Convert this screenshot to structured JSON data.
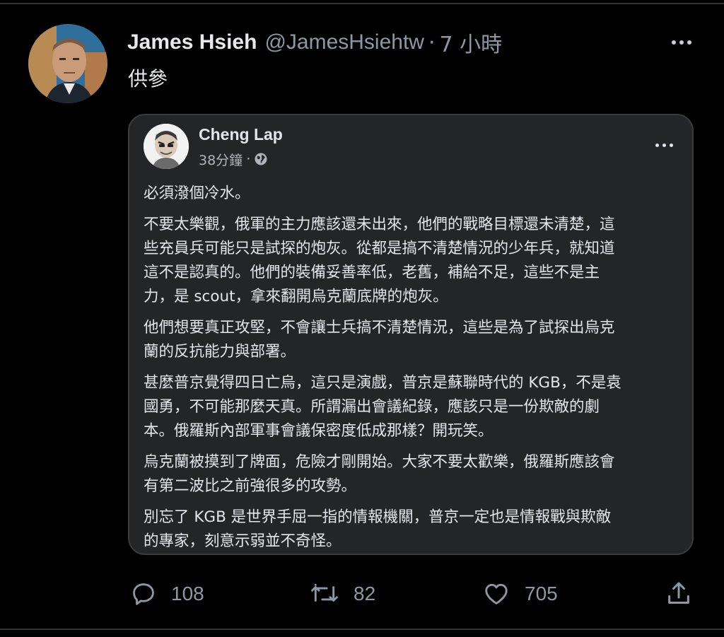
{
  "tweet": {
    "author_name": "James Hsieh",
    "author_handle": "@JamesHsiehtw",
    "separator": "·",
    "time_ago": "7 小時",
    "text": "供參",
    "icons": {
      "avatar": "profile-photo",
      "more": "more-horizontal-icon"
    }
  },
  "quoted_post": {
    "author_name": "Cheng Lap",
    "time_ago": "38分鐘",
    "separator": "·",
    "audience_icon": "globe-icon",
    "paragraphs": [
      "必須潑個冷水。",
      "不要太樂觀，俄軍的主力應該還未出來，他們的戰略目標還未清楚，這\n些充員兵可能只是試探的炮灰。從都是搞不清楚情況的少年兵，就知道\n這不是認真的。他們的裝備妥善率低，老舊，補給不足，這些不是主\n力，是 scout，拿來翻開烏克蘭底牌的炮灰。",
      "他們想要真正攻堅，不會讓士兵搞不清楚情況，這些是為了試探出烏克\n蘭的反抗能力與部署。",
      "甚麼普京覺得四日亡烏，這只是演戲，普京是蘇聯時代的 KGB，不是袁\n國勇，不可能那麼天真。所謂漏出會議紀錄，應該只是一份欺敵的劇\n本。俄羅斯內部軍事會議保密度低成那樣？開玩笑。",
      "烏克蘭被摸到了牌面，危險才剛開始。大家不要太歡樂，俄羅斯應該會\n有第二波比之前強很多的攻勢。",
      "別忘了 KGB 是世界手屈一指的情報機關，普京一定也是情報戰與欺敵\n的專家，刻意示弱並不奇怪。"
    ]
  },
  "actions": {
    "reply_count": "108",
    "retweet_count": "82",
    "like_count": "705",
    "icons": [
      "reply-icon",
      "retweet-icon",
      "like-icon",
      "share-icon"
    ]
  },
  "colors": {
    "background": "#000000",
    "card_background": "#242526",
    "primary_text": "#e7e9ea",
    "secondary_text": "#8b98a5",
    "divider": "#2f3336"
  }
}
